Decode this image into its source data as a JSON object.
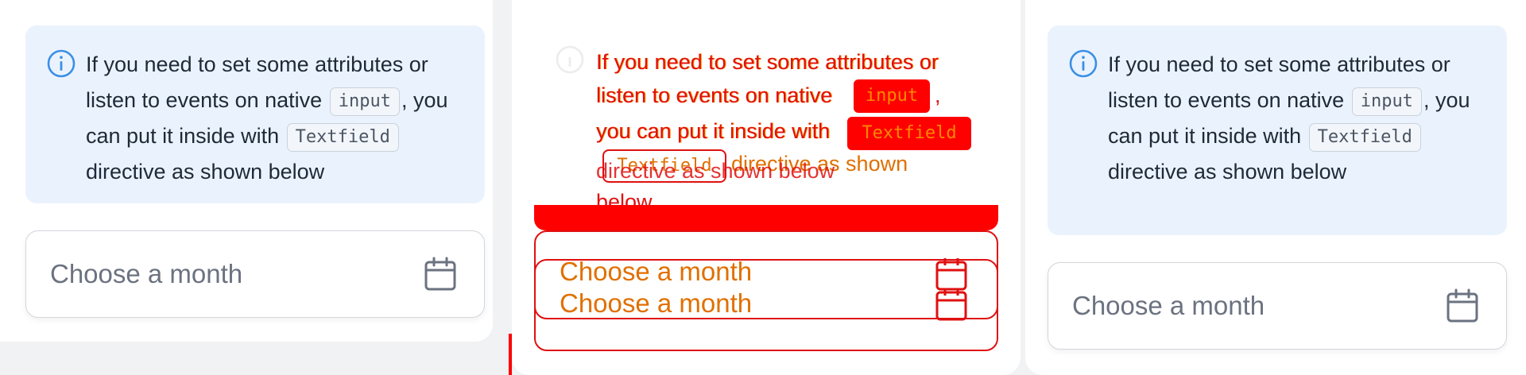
{
  "panels": [
    {
      "alert": {
        "text_before": "If you need to set some attributes or listen to events on native",
        "code1": "input",
        "text_mid": ", you can put it inside with",
        "code2": "Textfield",
        "text_after": "directive as shown below"
      },
      "field": {
        "placeholder": "Choose a month",
        "icon": "calendar-icon"
      }
    },
    {
      "alert": {
        "line1": "If you need to set some attributes or",
        "line2": "listen to events on native",
        "code1": "input",
        "line2_end": ",",
        "line3": "you can put it inside with",
        "code2": "Textfield",
        "line4_code": "Textfield",
        "line4_end": "directive as shown",
        "overlap_text": "directive as shown below",
        "line5": "below"
      },
      "field": {
        "placeholder": "Choose a month",
        "placeholder_dup": "Choose a month",
        "icon": "calendar-icon"
      }
    },
    {
      "alert": {
        "text_before": "If you need to set some attributes or listen to events on native",
        "code1": "input",
        "text_mid": ", you can put it inside with",
        "code2": "Textfield",
        "text_after": "directive as shown below"
      },
      "field": {
        "placeholder": "Choose a month",
        "icon": "calendar-icon"
      }
    }
  ],
  "colors": {
    "alert_bg": "#eaf3fd",
    "info_icon": "#3b8fe6",
    "glitch_red": "#ff0000",
    "glitch_orange": "#e07000"
  }
}
